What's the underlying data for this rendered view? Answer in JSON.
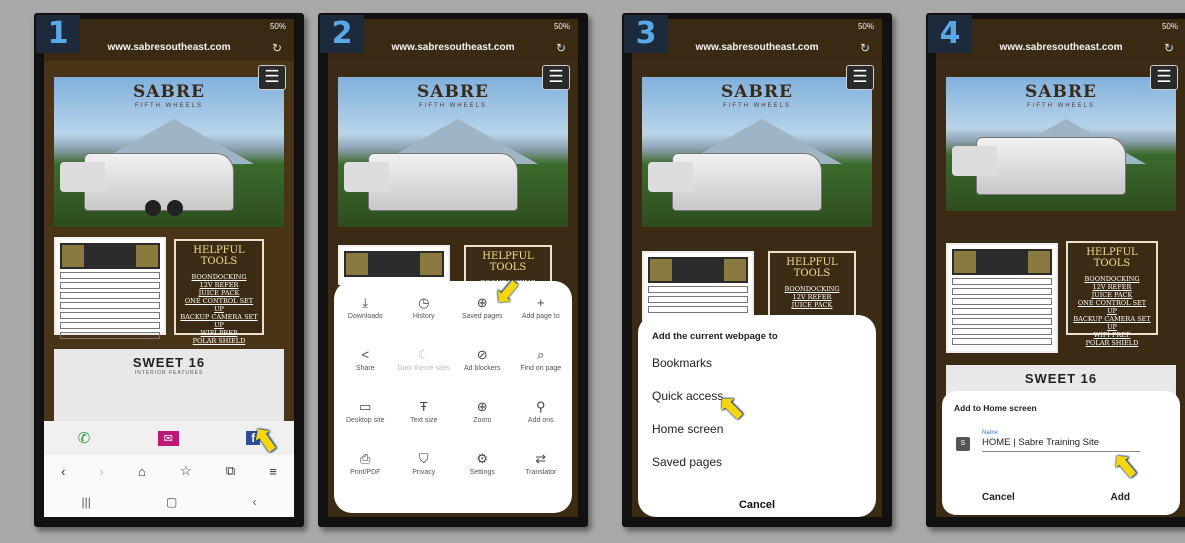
{
  "colors": {
    "background": "#a9a9a9",
    "site_brown": "#4a3418",
    "step_badge_text": "#5aa7e8",
    "arrow": "#f5d60a"
  },
  "common": {
    "url": "www.sabresoutheast.com",
    "status_text": "50%",
    "logo": "SABRE",
    "logo_sub": "FIFTH WHEELS",
    "tools_title": "HELPFUL TOOLS",
    "tools_items": [
      "BOONDOCKING",
      "12V REFER",
      "JUICE PACK",
      "ONE CONTROL SET UP",
      "BACKUP CAMERA SET UP",
      "WIFI PREP",
      "POLAR SHIELD"
    ],
    "sweet_title": "SWEET 16",
    "sweet_sub": "INTERIOR FEATURES"
  },
  "steps": [
    "1",
    "2",
    "3",
    "4"
  ],
  "phone2_menu": [
    {
      "label": "Downloads",
      "icon": "download-icon"
    },
    {
      "label": "History",
      "icon": "history-icon"
    },
    {
      "label": "Saved pages",
      "icon": "saved-pages-icon"
    },
    {
      "label": "Add page to",
      "icon": "plus-icon"
    },
    {
      "label": "Share",
      "icon": "share-icon"
    },
    {
      "label": "Dark theme sites",
      "icon": "moon-icon"
    },
    {
      "label": "Ad blockers",
      "icon": "ad-block-icon"
    },
    {
      "label": "Find on page",
      "icon": "find-icon"
    },
    {
      "label": "Desktop site",
      "icon": "desktop-icon"
    },
    {
      "label": "Text size",
      "icon": "text-size-icon"
    },
    {
      "label": "Zoom",
      "icon": "zoom-icon"
    },
    {
      "label": "Add ons",
      "icon": "addons-icon"
    },
    {
      "label": "Print/PDF",
      "icon": "print-icon"
    },
    {
      "label": "Privacy",
      "icon": "privacy-icon"
    },
    {
      "label": "Settings",
      "icon": "settings-icon"
    },
    {
      "label": "Translator",
      "icon": "translator-icon"
    }
  ],
  "phone3_sheet": {
    "title": "Add the current webpage to",
    "options": [
      "Bookmarks",
      "Quick access",
      "Home screen",
      "Saved pages"
    ],
    "cancel": "Cancel"
  },
  "phone4_dialog": {
    "title": "Add to Home screen",
    "field_label": "Name",
    "field_icon": "S",
    "field_value": "HOME | Sabre Training Site",
    "cancel": "Cancel",
    "add": "Add"
  }
}
